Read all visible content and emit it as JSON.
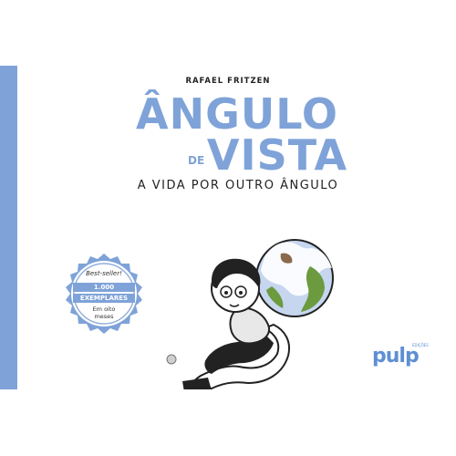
{
  "cover": {
    "author": "RAFAEL FRITZEN",
    "title_line1": "ÂNGULO",
    "title_line2": "DE",
    "title_line3": "VISTA",
    "subtitle": "A VIDA POR OUTRO ÂNGULO",
    "badge": {
      "line1": "Best-seller!",
      "line2": "1.000",
      "line3": "EXEMPLARES",
      "line4": "Em oito",
      "line5": "meses"
    },
    "publisher": "pulp",
    "publisher_small": "EDIÇÕES"
  },
  "colors": {
    "accent": "#7fa3d8",
    "publisher": "#5e8fd3",
    "text": "#222222"
  }
}
